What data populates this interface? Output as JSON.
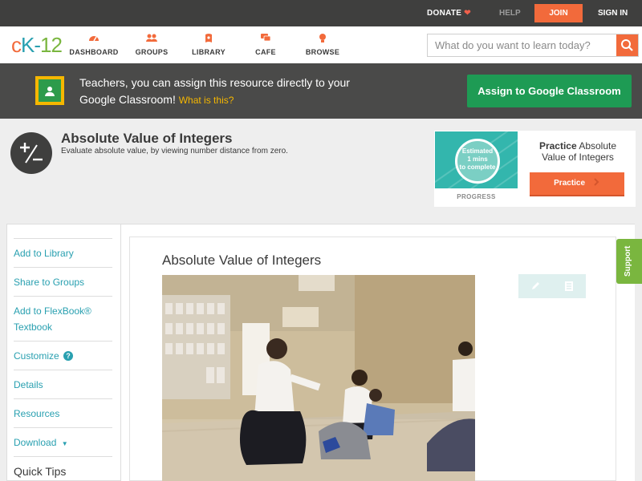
{
  "topbar": {
    "donate": "DONATE",
    "help": "HELP",
    "join": "JOIN",
    "signin": "SIGN IN"
  },
  "logo": {
    "c": "c",
    "k": "K-",
    "n": "12"
  },
  "nav": {
    "items": [
      {
        "label": "DASHBOARD",
        "icon": "dashboard-icon"
      },
      {
        "label": "GROUPS",
        "icon": "groups-icon"
      },
      {
        "label": "LIBRARY",
        "icon": "library-icon"
      },
      {
        "label": "CAFE",
        "icon": "cafe-icon"
      },
      {
        "label": "BROWSE",
        "icon": "browse-icon"
      }
    ]
  },
  "search": {
    "placeholder": "What do you want to learn today?"
  },
  "banner": {
    "text": "Teachers, you can assign this resource directly to your Google Classroom!",
    "what": "What is this?",
    "assign": "Assign to Google Classroom"
  },
  "header": {
    "title": "Absolute Value of Integers",
    "subtitle": "Evaluate absolute value, by viewing number distance from zero."
  },
  "practice": {
    "estimated": "Estimated",
    "mins": "1 mins",
    "complete": "to complete",
    "progress": "PROGRESS",
    "title_bold": "Practice",
    "title_rest": "Absolute Value of Integers",
    "button": "Practice"
  },
  "sidebar": {
    "items": [
      {
        "label": "Add to Library"
      },
      {
        "label": "Share to Groups"
      },
      {
        "label": "Add to FlexBook® Textbook"
      },
      {
        "label": "Customize"
      },
      {
        "label": "Details"
      },
      {
        "label": "Resources"
      },
      {
        "label": "Download"
      },
      {
        "label": "Quick Tips"
      }
    ]
  },
  "content": {
    "title": "Absolute Value of Integers"
  },
  "support": {
    "label": "Support"
  },
  "colors": {
    "brand_orange": "#f26a3b",
    "brand_teal": "#29a0b0",
    "brand_green": "#7ab63f",
    "classroom_green": "#1e9b54"
  }
}
